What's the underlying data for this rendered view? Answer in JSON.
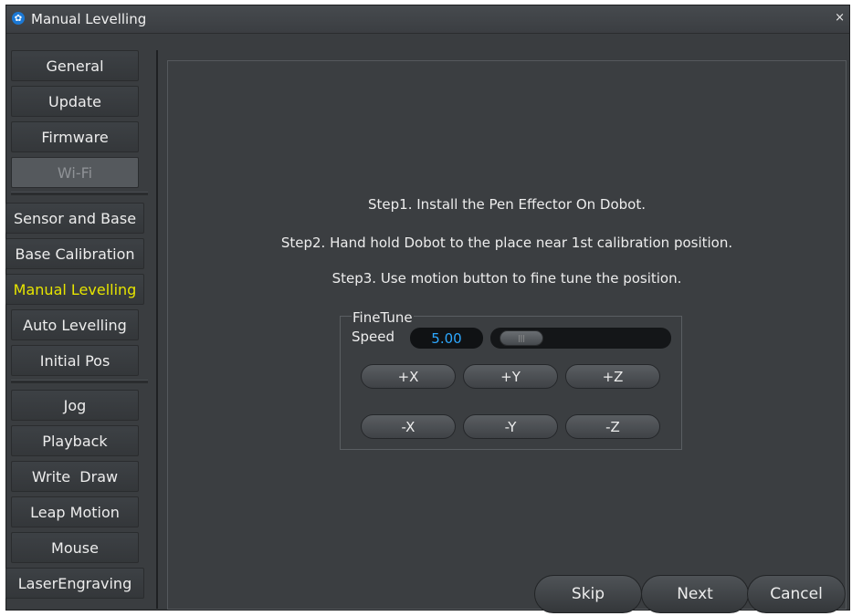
{
  "window": {
    "title": "Manual Levelling",
    "close_glyph": "×"
  },
  "sidebar": {
    "items": [
      {
        "label": "General",
        "state": "normal"
      },
      {
        "label": "Update",
        "state": "normal"
      },
      {
        "label": "Firmware",
        "state": "normal"
      },
      {
        "label": "Wi-Fi",
        "state": "disabled"
      },
      {
        "label": "Sensor and Base",
        "state": "normal"
      },
      {
        "label": "Base Calibration",
        "state": "normal"
      },
      {
        "label": "Manual Levelling",
        "state": "active"
      },
      {
        "label": "Auto Levelling",
        "state": "normal"
      },
      {
        "label": "Initial Pos",
        "state": "normal"
      },
      {
        "label": "Jog",
        "state": "normal"
      },
      {
        "label": "Playback",
        "state": "normal"
      },
      {
        "label": "Write  Draw",
        "state": "normal"
      },
      {
        "label": "Leap Motion",
        "state": "normal"
      },
      {
        "label": "Mouse",
        "state": "normal"
      },
      {
        "label": "LaserEngraving",
        "state": "normal"
      }
    ]
  },
  "main": {
    "steps": [
      "Step1. Install the Pen Effector On Dobot.",
      "Step2. Hand hold Dobot to the place near 1st calibration position.",
      "Step3. Use motion button to fine tune the position."
    ],
    "finetune": {
      "legend": "FineTune",
      "speed_label": "Speed",
      "speed_value": "5.00",
      "slider_level": 0.0,
      "buttons_positive": [
        "+X",
        "+Y",
        "+Z"
      ],
      "buttons_negative": [
        "-X",
        "-Y",
        "-Z"
      ]
    }
  },
  "footer": {
    "skip_label": "Skip",
    "next_label": "Next",
    "cancel_label": "Cancel"
  },
  "colors": {
    "active_item": "#e6e400",
    "speed_value": "#2da8ff",
    "background": "#3a3d40"
  }
}
